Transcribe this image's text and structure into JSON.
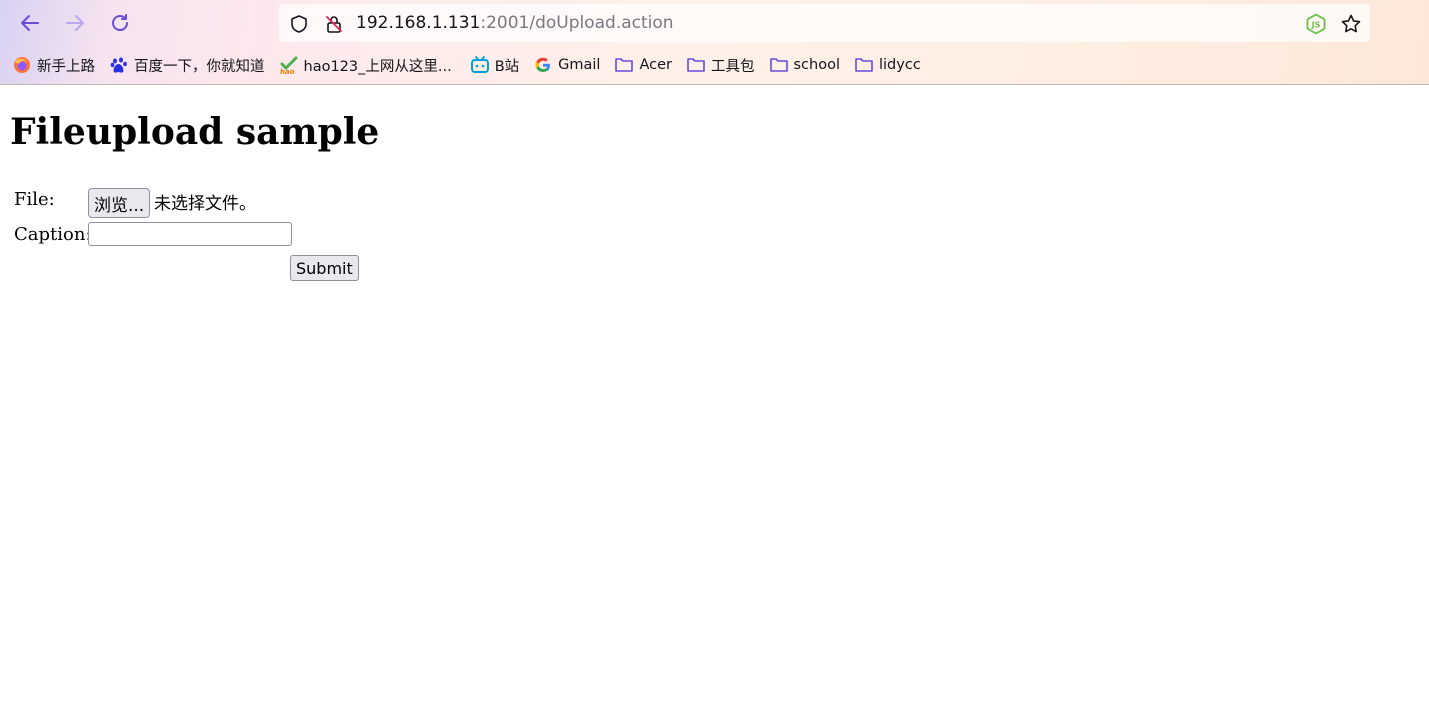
{
  "browser": {
    "url": {
      "host": "192.168.1.131",
      "rest": ":2001/doUpload.action"
    },
    "bookmarks": [
      {
        "label": "新手上路",
        "icon": "firefox-icon"
      },
      {
        "label": "百度一下，你就知道",
        "icon": "baidu-paw-icon"
      },
      {
        "label": "hao123_上网从这里...",
        "icon": "hao123-icon"
      },
      {
        "label": "B站",
        "icon": "bilibili-icon"
      },
      {
        "label": "Gmail",
        "icon": "google-icon"
      },
      {
        "label": "Acer",
        "icon": "folder-icon"
      },
      {
        "label": "工具包",
        "icon": "folder-icon"
      },
      {
        "label": "school",
        "icon": "folder-icon"
      },
      {
        "label": "lidycc",
        "icon": "folder-icon"
      }
    ]
  },
  "page": {
    "title": "Fileupload sample",
    "form": {
      "file_label": "File:",
      "browse_label": "浏览...",
      "file_status": "未选择文件。",
      "caption_label": "Caption:",
      "caption_value": "",
      "submit_label": "Submit"
    }
  },
  "colors": {
    "accent": "#7542e5",
    "node_green": "#6cc24a"
  }
}
